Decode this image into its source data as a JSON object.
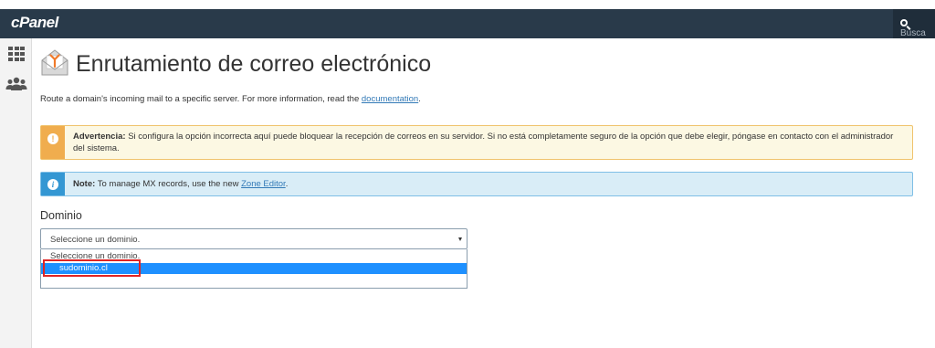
{
  "app": {
    "logo": "cPanel"
  },
  "header": {
    "search_placeholder": "Busca"
  },
  "page": {
    "title": "Enrutamiento de correo electrónico",
    "description_prefix": "Route a domain's incoming mail to a specific server. For more information, read the ",
    "description_link": "documentation",
    "description_suffix": "."
  },
  "warning": {
    "label": "Advertencia:",
    "text": " Si configura la opción incorrecta aquí puede bloquear la recepción de correos en su servidor. Si no está completamente seguro de la opción que debe elegir, póngase en contacto con el administrador del sistema.",
    "badge": "!"
  },
  "note": {
    "label": "Note:",
    "text_prefix": " To manage MX records, use the new ",
    "link": "Zone Editor",
    "text_suffix": ".",
    "badge": "i"
  },
  "domain_field": {
    "label": "Dominio",
    "selected": "Seleccione un dominio.",
    "options": [
      "Seleccione un dominio.",
      "sudominio.cl"
    ]
  },
  "colors": {
    "navbar": "#293a4a",
    "warning_accent": "#f0ad4e",
    "info_accent": "#3497d3",
    "selected_option": "#1e90ff",
    "annotation_box": "#e02424"
  }
}
